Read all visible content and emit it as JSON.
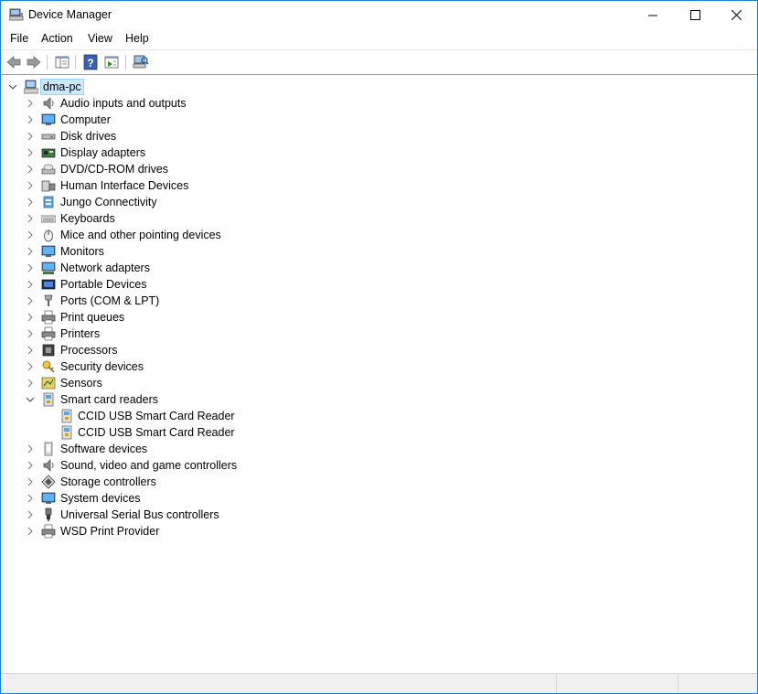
{
  "window": {
    "title": "Device Manager"
  },
  "menu": [
    "File",
    "Action",
    "View",
    "Help"
  ],
  "tree": {
    "root": "dma-pc",
    "categories": [
      {
        "label": "Audio inputs and outputs",
        "icon": "speaker-icon"
      },
      {
        "label": "Computer",
        "icon": "monitor-icon"
      },
      {
        "label": "Disk drives",
        "icon": "disk-drive-icon"
      },
      {
        "label": "Display adapters",
        "icon": "display-adapter-icon"
      },
      {
        "label": "DVD/CD-ROM drives",
        "icon": "dvd-drive-icon"
      },
      {
        "label": "Human Interface Devices",
        "icon": "hid-icon"
      },
      {
        "label": "Jungo Connectivity",
        "icon": "jungo-icon"
      },
      {
        "label": "Keyboards",
        "icon": "keyboard-icon"
      },
      {
        "label": "Mice and other pointing devices",
        "icon": "mouse-icon"
      },
      {
        "label": "Monitors",
        "icon": "monitor-icon"
      },
      {
        "label": "Network adapters",
        "icon": "network-adapter-icon"
      },
      {
        "label": "Portable Devices",
        "icon": "portable-device-icon"
      },
      {
        "label": "Ports (COM & LPT)",
        "icon": "port-icon"
      },
      {
        "label": "Print queues",
        "icon": "printer-icon"
      },
      {
        "label": "Printers",
        "icon": "printer-icon"
      },
      {
        "label": "Processors",
        "icon": "processor-icon"
      },
      {
        "label": "Security devices",
        "icon": "security-key-icon"
      },
      {
        "label": "Sensors",
        "icon": "sensor-icon"
      },
      {
        "label": "Smart card readers",
        "icon": "smart-card-reader-icon",
        "expanded": true,
        "children": [
          {
            "label": "CCID USB Smart Card Reader"
          },
          {
            "label": "CCID USB Smart Card Reader"
          }
        ]
      },
      {
        "label": "Software devices",
        "icon": "software-device-icon"
      },
      {
        "label": "Sound, video and game controllers",
        "icon": "speaker-icon"
      },
      {
        "label": "Storage controllers",
        "icon": "storage-controller-icon"
      },
      {
        "label": "System devices",
        "icon": "monitor-icon"
      },
      {
        "label": "Universal Serial Bus controllers",
        "icon": "usb-icon"
      },
      {
        "label": "WSD Print Provider",
        "icon": "printer-icon"
      }
    ]
  },
  "colors": {
    "border": "#1883d7",
    "selection": "#cce8ff",
    "statusbar": "#f0f0f0"
  }
}
